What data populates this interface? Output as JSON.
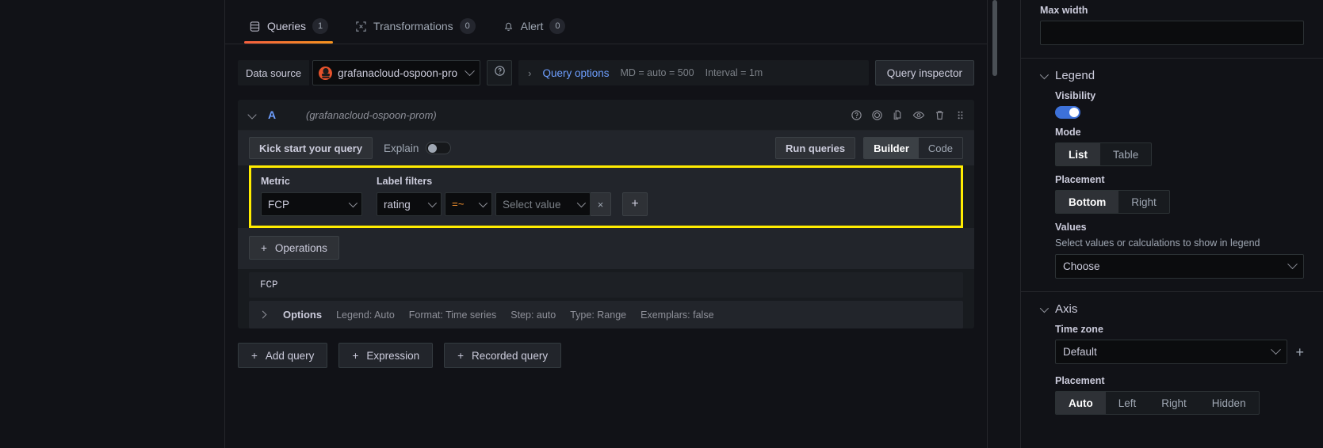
{
  "tabs": [
    {
      "label": "Queries",
      "badge": "1",
      "icon": "database-icon",
      "active": true
    },
    {
      "label": "Transformations",
      "badge": "0",
      "icon": "transform-icon",
      "active": false
    },
    {
      "label": "Alert",
      "badge": "0",
      "icon": "bell-icon",
      "active": false
    }
  ],
  "datasource_row": {
    "label": "Data source",
    "selected": "grafanacloud-ospoon-pro",
    "help_icon": "help-circle-icon",
    "query_options_caret": "›",
    "query_options_label": "Query options",
    "max_data_points": "MD = auto = 500",
    "interval": "Interval = 1m",
    "inspector_button": "Query inspector"
  },
  "query": {
    "ref_id": "A",
    "datasource_note": "(grafanacloud-ospoon-prom)",
    "header_icons": [
      "help-circle-icon",
      "disable-query-icon",
      "duplicate-query-icon",
      "hide-response-icon",
      "remove-query-icon",
      "drag-handle-icon"
    ],
    "toolbar": {
      "kick_start": "Kick start your query",
      "explain_label": "Explain",
      "explain_on": false,
      "run_queries": "Run queries",
      "mode_options": [
        "Builder",
        "Code"
      ],
      "mode_selected": "Builder"
    },
    "builder": {
      "metric_label": "Metric",
      "metric_value": "FCP",
      "label_filters_label": "Label filters",
      "filter_label": "rating",
      "filter_operator": "=~",
      "filter_value_placeholder": "Select value",
      "remove_filter": "×",
      "add_filter": "+"
    },
    "operations_button": "Operations",
    "operations_plus": "+",
    "preview_expr": "FCP",
    "options_row": {
      "title": "Options",
      "items": [
        "Legend: Auto",
        "Format: Time series",
        "Step: auto",
        "Type: Range",
        "Exemplars: false"
      ]
    }
  },
  "bottom_buttons": [
    {
      "label": "Add query",
      "icon": "plus-icon"
    },
    {
      "label": "Expression",
      "icon": "plus-icon"
    },
    {
      "label": "Recorded query",
      "icon": "plus-icon"
    }
  ],
  "options_pane": {
    "max_width": {
      "label": "Max width",
      "value": "",
      "placeholder": ""
    },
    "legend": {
      "title": "Legend",
      "visibility_label": "Visibility",
      "visibility_on": true,
      "mode_label": "Mode",
      "mode_options": [
        "List",
        "Table"
      ],
      "mode_selected": "List",
      "placement_label": "Placement",
      "placement_options": [
        "Bottom",
        "Right"
      ],
      "placement_selected": "Bottom",
      "values_label": "Values",
      "values_desc": "Select values or calculations to show in legend",
      "values_placeholder": "Choose"
    },
    "axis": {
      "title": "Axis",
      "timezone_label": "Time zone",
      "timezone_value": "Default",
      "timezone_add": "+",
      "placement_label": "Placement",
      "placement_options": [
        "Auto",
        "Left",
        "Right",
        "Hidden"
      ],
      "placement_selected": "Auto"
    }
  },
  "colors": {
    "accent_blue": "#6e9fff",
    "highlight_yellow": "#ffec00",
    "orange_operator": "#ff9830",
    "toggle_blue": "#3d71d9",
    "tab_underline": "#f55f3e"
  }
}
